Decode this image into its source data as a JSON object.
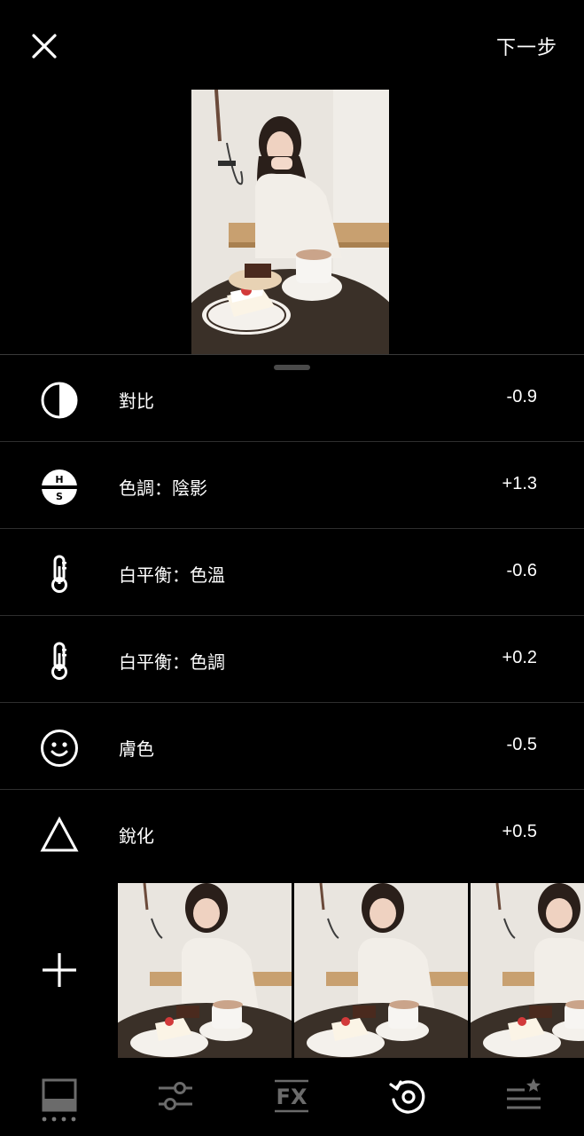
{
  "header": {
    "next_label": "下一步"
  },
  "adjustments": [
    {
      "label": "對比",
      "value": "-0.9",
      "icon": "contrast-icon"
    },
    {
      "label": "色調：陰影",
      "value": "+1.3",
      "icon": "hs-split-tone-icon"
    },
    {
      "label": "白平衡：色溫",
      "value": "-0.6",
      "icon": "thermometer-icon"
    },
    {
      "label": "白平衡：色調",
      "value": "+0.2",
      "icon": "thermometer-icon"
    },
    {
      "label": "膚色",
      "value": "-0.5",
      "icon": "smiley-icon"
    },
    {
      "label": "銳化",
      "value": "+0.5",
      "icon": "triangle-icon"
    }
  ],
  "bottom_nav": [
    "presets-icon",
    "sliders-icon",
    "fx-icon",
    "history-icon",
    "recipes-icon"
  ],
  "colors": {
    "background": "#000000",
    "text": "#ffffff",
    "divider": "#2e2e2e",
    "inactive_icon": "#6b6b6b"
  }
}
